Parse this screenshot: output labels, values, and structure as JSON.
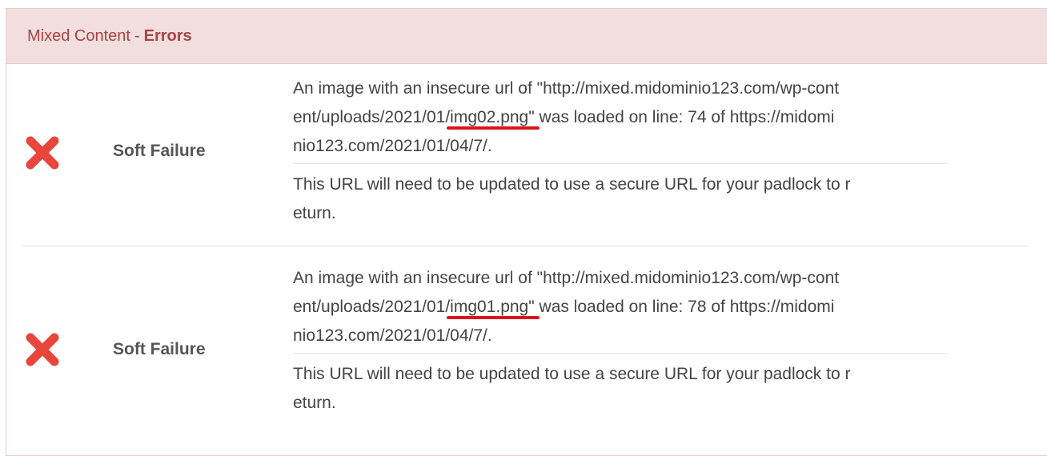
{
  "header": {
    "section": "Mixed Content",
    "separator": "-",
    "level": "Errors"
  },
  "colors": {
    "header_bg": "#f2dede",
    "header_text": "#a94442",
    "fail_icon": "#e8453c",
    "underline": "#d9151b"
  },
  "results": [
    {
      "icon": "x-mark-icon",
      "status": "Soft Failure",
      "detail": {
        "line1": "An image with an insecure url of \"http://mixed.midominio123.com/wp-cont",
        "line2_pre": "ent/uploads/2021/01/",
        "line2_highlight": "img02.png\"",
        "line2_post": " was loaded on line: 74 of https://midomi",
        "line3": "nio123.com/2021/01/04/7/."
      },
      "advice": {
        "line1": "This URL will need to be updated to use a secure URL for your padlock to r",
        "line2": "eturn."
      }
    },
    {
      "icon": "x-mark-icon",
      "status": "Soft Failure",
      "detail": {
        "line1": "An image with an insecure url of \"http://mixed.midominio123.com/wp-cont",
        "line2_pre": "ent/uploads/2021/01/",
        "line2_highlight": "img01.png\"",
        "line2_post": " was loaded on line: 78 of https://midomi",
        "line3": "nio123.com/2021/01/04/7/."
      },
      "advice": {
        "line1": "This URL will need to be updated to use a secure URL for your padlock to r",
        "line2": "eturn."
      }
    }
  ]
}
